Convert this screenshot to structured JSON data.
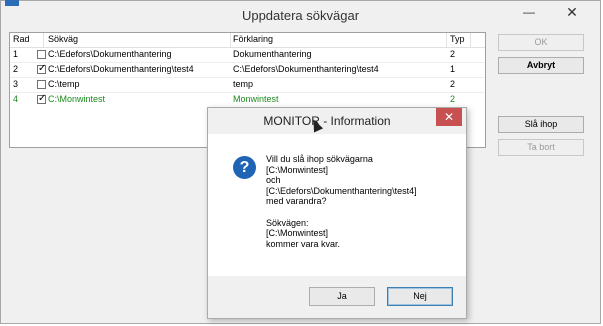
{
  "window": {
    "title": "Uppdatera sökvägar",
    "minimize": "—",
    "close": "✕"
  },
  "table": {
    "headers": [
      "Rad",
      "Sökväg",
      "Förklaring",
      "Typ"
    ],
    "rows": [
      {
        "rad": "1",
        "checked": false,
        "path": "C:\\Edefors\\Dokumenthantering",
        "desc": "Dokumenthantering",
        "typ": "2",
        "highlight": false
      },
      {
        "rad": "2",
        "checked": true,
        "path": "C:\\Edefors\\Dokumenthantering\\test4",
        "desc": "C:\\Edefors\\Dokumenthantering\\test4",
        "typ": "1",
        "highlight": false
      },
      {
        "rad": "3",
        "checked": false,
        "path": "C:\\temp",
        "desc": "temp",
        "typ": "2",
        "highlight": false
      },
      {
        "rad": "4",
        "checked": true,
        "path": "C:\\Monwintest",
        "desc": "Monwintest",
        "typ": "2",
        "highlight": true
      }
    ]
  },
  "buttons": {
    "ok": "OK",
    "avbryt": "Avbryt",
    "sla_ihop": "Slå ihop",
    "ta_bort": "Ta bort"
  },
  "dialog": {
    "title": "MONITOR - Information",
    "close": "✕",
    "icon": "?",
    "message": [
      "Vill du slå ihop sökvägarna",
      "[C:\\Monwintest]",
      "och",
      "[C:\\Edefors\\Dokumenthantering\\test4]",
      "med varandra?",
      "",
      "Sökvägen:",
      "[C:\\Monwintest]",
      "kommer vara kvar."
    ],
    "yes": "Ja",
    "no": "Nej"
  },
  "colors": {
    "highlight_row_text": "#1d8a1d",
    "dialog_close_bg": "#c75050",
    "question_icon_bg": "#1f64b5"
  }
}
